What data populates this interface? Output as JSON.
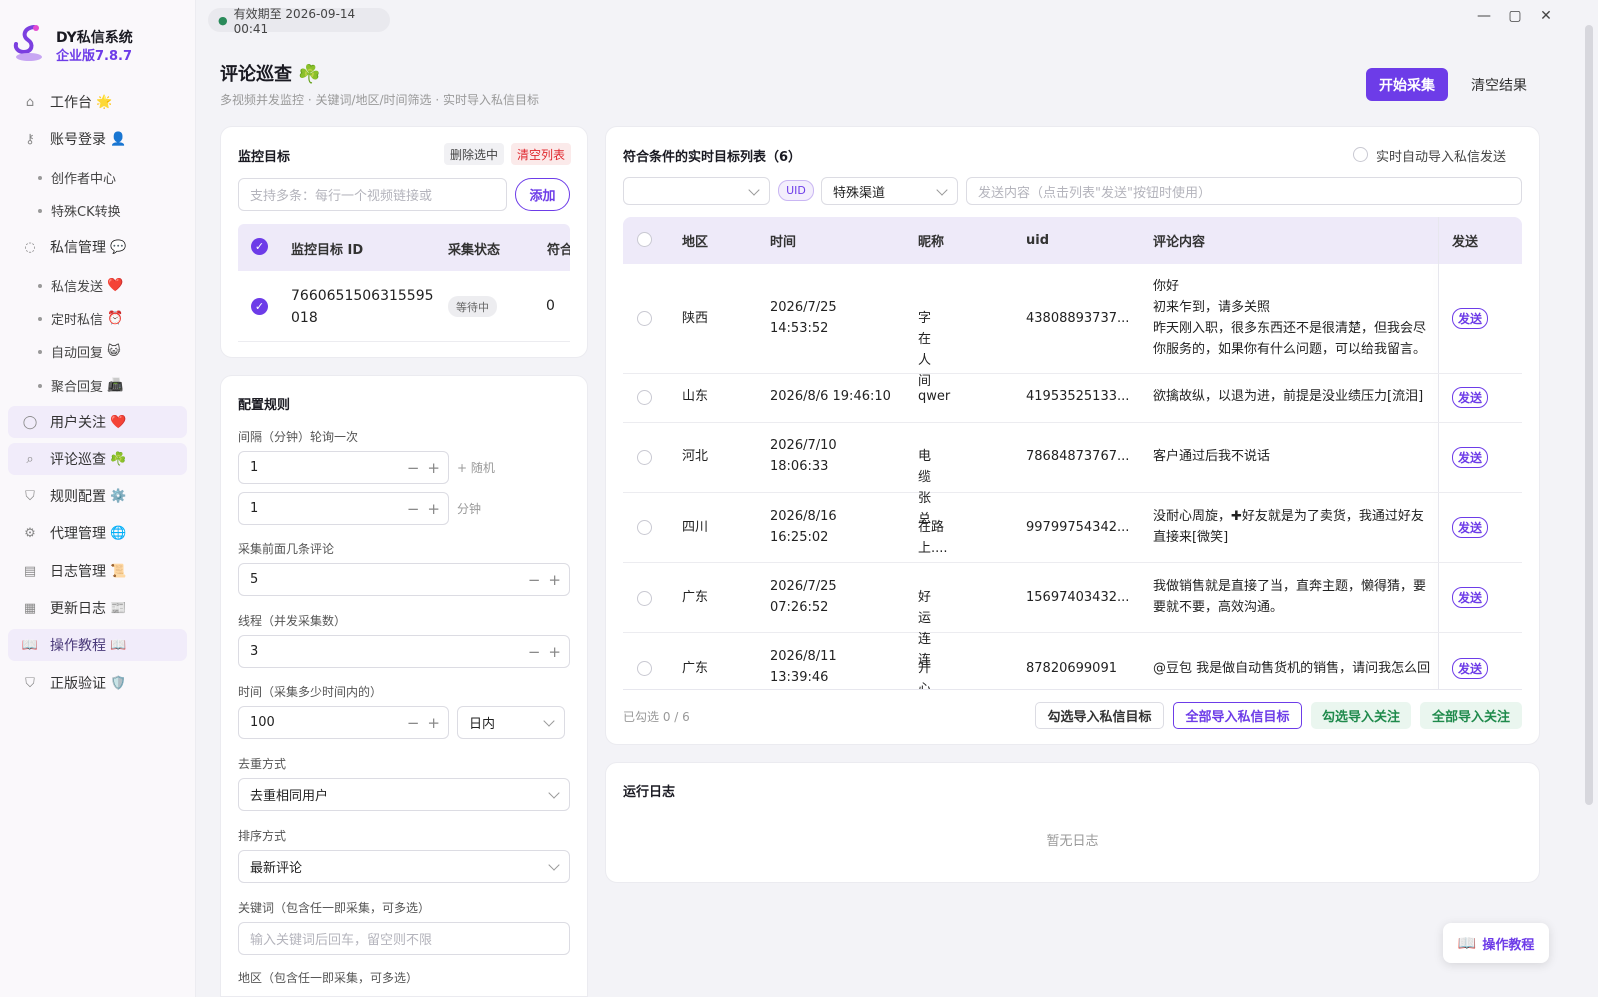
{
  "brand": {
    "name": "DY私信系统",
    "edition": "企业版7.8.7"
  },
  "topbar": {
    "validity": "有效期至 2026-09-14 00:41"
  },
  "sidebar": {
    "items": [
      {
        "label": "工作台",
        "emoji": "🌟"
      },
      {
        "label": "账号登录",
        "emoji": "👤"
      },
      {
        "label": "私信管理",
        "emoji": "💬"
      },
      {
        "label": "用户关注",
        "emoji": "❤️"
      },
      {
        "label": "评论巡查",
        "emoji": "☘️"
      },
      {
        "label": "规则配置",
        "emoji": "⚙️"
      },
      {
        "label": "代理管理",
        "emoji": "🌐"
      },
      {
        "label": "日志管理",
        "emoji": "📜"
      },
      {
        "label": "更新日志",
        "emoji": "📰"
      },
      {
        "label": "操作教程",
        "emoji": "📖"
      },
      {
        "label": "正版验证",
        "emoji": "🛡️"
      }
    ],
    "subitems": [
      {
        "label": "创作者中心",
        "emoji": ""
      },
      {
        "label": "特殊CK转换",
        "emoji": ""
      },
      {
        "label": "私信发送",
        "emoji": "❤️"
      },
      {
        "label": "定时私信",
        "emoji": "⏰"
      },
      {
        "label": "自动回复",
        "emoji": "😺"
      },
      {
        "label": "聚合回复",
        "emoji": "📠"
      }
    ]
  },
  "page": {
    "title": "评论巡查 ☘️",
    "subtitle": "多视频并发监控 · 关键词/地区/时间筛选 · 实时导入私信目标",
    "start_btn": "开始采集",
    "clear_btn": "清空结果"
  },
  "monitor": {
    "title": "监控目标",
    "delete_selected": "删除选中",
    "clear_list": "清空列表",
    "input_placeholder": "支持多条：每行一个视频链接或",
    "add_btn": "添加",
    "headers": {
      "id": "监控目标 ID",
      "status": "采集状态",
      "count": "符合"
    },
    "rows": [
      {
        "id_line1": "7660651506315595",
        "id_line2": "018",
        "status": "等待中",
        "count": "0"
      }
    ]
  },
  "config": {
    "title": "配置规则",
    "interval_label": "间隔（分钟）轮询一次",
    "interval_value": "1",
    "random_hint": "+ 随机",
    "interval_random_value": "1",
    "minutes_hint": "分钟",
    "first_n_label": "采集前面几条评论",
    "first_n_value": "5",
    "threads_label": "线程（并发采集数）",
    "threads_value": "3",
    "time_label": "时间（采集多少时间内的）",
    "time_value": "100",
    "time_unit": "日内",
    "dedup_label": "去重方式",
    "dedup_value": "去重相同用户",
    "sort_label": "排序方式",
    "sort_value": "最新评论",
    "keyword_label": "关键词（包含任一即采集，可多选）",
    "keyword_placeholder": "输入关键词后回车，留空则不限",
    "region_label": "地区（包含任一即采集，可多选）"
  },
  "targets": {
    "title": "符合条件的实时目标列表（6）",
    "auto_import": "实时自动导入私信发送",
    "uid_tag": "UID",
    "channel": "特殊渠道",
    "send_placeholder": "发送内容（点击列表\"发送\"按钮时使用）",
    "headers": {
      "region": "地区",
      "time": "时间",
      "nick": "昵称",
      "uid": "uid",
      "comment": "评论内容",
      "send": "发送"
    },
    "send_label": "发送",
    "rows": [
      {
        "region": "陕西",
        "time1": "2026/7/25",
        "time2": "14:53:52",
        "nick": "字在人间",
        "uid": "43808893737...",
        "c1": "你好",
        "c2": "初来乍到，请多关照",
        "c3": "昨天刚入职，很多东西还不是很清楚，但我会尽",
        "c4": "你服务的，如果你有什么问题，可以给我留言。"
      },
      {
        "region": "山东",
        "time1": "2026/8/6 19:46:10",
        "time2": "",
        "nick": "qwer",
        "uid": "41953525133...",
        "c1": "欲擒故纵，以退为进，前提是没业绩压力[流泪]",
        "c2": "",
        "c3": "",
        "c4": ""
      },
      {
        "region": "河北",
        "time1": "2026/7/10",
        "time2": "18:06:33",
        "nick": "电缆张总",
        "uid": "78684873767...",
        "c1": "客户通过后我不说话",
        "c2": "",
        "c3": "",
        "c4": ""
      },
      {
        "region": "四川",
        "time1": "2026/8/16",
        "time2": "16:25:02",
        "nick": "在路上....",
        "uid": "99799754342...",
        "c1": "没耐心周旋，✚好友就是为了卖货，我通过好友",
        "c2": "直接来[微笑]",
        "c3": "",
        "c4": ""
      },
      {
        "region": "广东",
        "time1": "2026/7/25",
        "time2": "07:26:52",
        "nick": "好运连连",
        "uid": "15697403432...",
        "c1": "我做销售就是直接了当，直奔主题，懒得猜，要",
        "c2": "要就不要，高效沟通。",
        "c3": "",
        "c4": ""
      },
      {
        "region": "广东",
        "time1": "2026/8/11",
        "time2": "13:39:46",
        "nick": "开心爱吃糖",
        "uid": "87820699091",
        "c1": "@豆包 我是做自动售货机的销售，请问我怎么回",
        "c2": "",
        "c3": "",
        "c4": ""
      }
    ],
    "selected_count": "已勾选 0 / 6",
    "btn_import_selected": "勾选导入私信目标",
    "btn_import_all": "全部导入私信目标",
    "btn_follow_selected": "勾选导入关注",
    "btn_follow_all": "全部导入关注"
  },
  "log": {
    "title": "运行日志",
    "empty": "暂无日志"
  },
  "help_btn": "操作教程",
  "colors": {
    "accent": "#6d3ce8",
    "danger": "#e0282e",
    "green": "#1f8a4c"
  }
}
